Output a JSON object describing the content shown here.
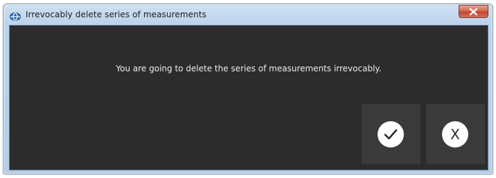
{
  "window": {
    "title": "Irrevocably delete series of measurements",
    "title_icon": "app-logo-icon",
    "close_icon": "close-icon"
  },
  "dialog": {
    "message": "You are going to delete the series of measurements irrevocably.",
    "confirm_icon": "checkmark-icon",
    "cancel_label": "X"
  },
  "colors": {
    "content_background": "#2c2c2c",
    "button_background": "#3a3a3a",
    "message_text": "#ececec",
    "close_button": "#c9503a"
  }
}
